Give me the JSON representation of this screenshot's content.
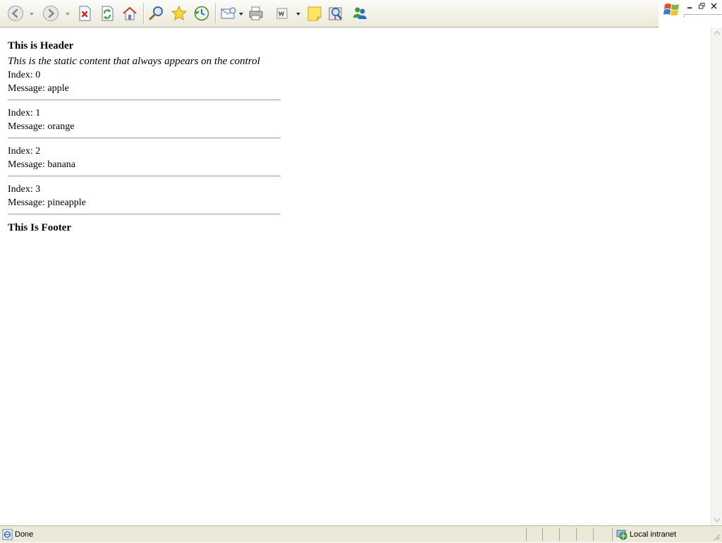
{
  "toolbar": {
    "buttons": [
      {
        "icon": "back-arrow-icon"
      },
      {
        "icon": "forward-arrow-icon"
      },
      {
        "icon": "stop-icon"
      },
      {
        "icon": "refresh-icon"
      },
      {
        "icon": "home-icon"
      },
      {
        "icon": "search-icon"
      },
      {
        "icon": "favorites-star-icon"
      },
      {
        "icon": "history-icon"
      },
      {
        "icon": "mail-icon"
      },
      {
        "icon": "print-icon"
      },
      {
        "icon": "edit-word-icon"
      },
      {
        "icon": "note-icon"
      },
      {
        "icon": "research-icon"
      },
      {
        "icon": "messenger-icon"
      }
    ]
  },
  "page": {
    "header": "This is Header",
    "static_content": "This is the static content that always appears on the control",
    "items": [
      {
        "index_line": "Index: 0",
        "message_line": "Message: apple"
      },
      {
        "index_line": "Index: 1",
        "message_line": "Message: orange"
      },
      {
        "index_line": "Index: 2",
        "message_line": "Message: banana"
      },
      {
        "index_line": "Index: 3",
        "message_line": "Message: pineapple"
      }
    ],
    "footer": "This Is Footer"
  },
  "statusbar": {
    "status_text": "Done",
    "zone_text": "Local intranet"
  },
  "colors": {
    "toolbar_bg": "#ece9d8",
    "rule": "#a6a6a6",
    "accent_blue": "#2c6bbf"
  }
}
